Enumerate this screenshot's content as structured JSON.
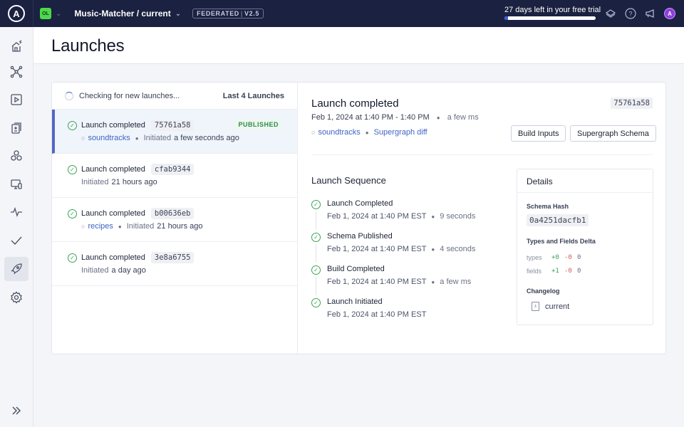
{
  "topbar": {
    "logo_letter": "A",
    "org_initials": "OL",
    "graph_name": "Music-Matcher / current",
    "badge_type": "FEDERATED",
    "badge_version": "V2.5",
    "trial_text": "27 days left in your free trial",
    "trial_progress_percent": 4,
    "avatar_initial": "A",
    "icons": [
      "graph-layers-icon",
      "help-icon",
      "announcements-icon",
      "avatar"
    ]
  },
  "sidebar": {
    "items": [
      {
        "name": "home",
        "icon": "house-icon",
        "active": false
      },
      {
        "name": "schema",
        "icon": "graph-nodes-icon",
        "active": false
      },
      {
        "name": "explorer",
        "icon": "play-icon",
        "active": false
      },
      {
        "name": "changelog",
        "icon": "diff-icon",
        "active": false
      },
      {
        "name": "subgraphs",
        "icon": "cubes-icon",
        "active": false
      },
      {
        "name": "clients",
        "icon": "devices-icon",
        "active": false
      },
      {
        "name": "insights",
        "icon": "pulse-icon",
        "active": false
      },
      {
        "name": "checks",
        "icon": "checkmark-icon",
        "active": false
      },
      {
        "name": "launches",
        "icon": "rocket-icon",
        "active": true
      },
      {
        "name": "settings",
        "icon": "gear-icon",
        "active": false
      }
    ],
    "expand_icon": "double-chevron-right-icon"
  },
  "page": {
    "title": "Launches"
  },
  "launch_list": {
    "status_text": "Checking for new launches...",
    "count_label": "Last 4 Launches",
    "items": [
      {
        "title": "Launch completed",
        "hash": "75761a58",
        "badge": "PUBLISHED",
        "subgraph": "soundtracks",
        "initiated_label": "Initiated",
        "initiated_time": "a few seconds ago",
        "selected": true
      },
      {
        "title": "Launch completed",
        "hash": "cfab9344",
        "badge": "",
        "subgraph": "",
        "initiated_label": "Initiated",
        "initiated_time": "21 hours ago",
        "selected": false
      },
      {
        "title": "Launch completed",
        "hash": "b00636eb",
        "badge": "",
        "subgraph": "recipes",
        "initiated_label": "Initiated",
        "initiated_time": "21 hours ago",
        "selected": false
      },
      {
        "title": "Launch completed",
        "hash": "3e8a6755",
        "badge": "",
        "subgraph": "",
        "initiated_label": "Initiated",
        "initiated_time": "a day ago",
        "selected": false
      }
    ]
  },
  "detail": {
    "title": "Launch completed",
    "hash": "75761a58",
    "time_range": "Feb 1, 2024 at 1:40 PM - 1:40 PM",
    "duration": "a few ms",
    "subgraph_link": "soundtracks",
    "diff_link": "Supergraph diff",
    "build_inputs_label": "Build Inputs",
    "supergraph_schema_label": "Supergraph Schema",
    "sequence_title": "Launch Sequence",
    "sequence": [
      {
        "name": "Launch Completed",
        "time": "Feb 1, 2024 at 1:40 PM EST",
        "duration": "9 seconds"
      },
      {
        "name": "Schema Published",
        "time": "Feb 1, 2024 at 1:40 PM EST",
        "duration": "4 seconds"
      },
      {
        "name": "Build Completed",
        "time": "Feb 1, 2024 at 1:40 PM EST",
        "duration": "a few ms"
      },
      {
        "name": "Launch Initiated",
        "time": "Feb 1, 2024 at 1:40 PM EST",
        "duration": ""
      }
    ],
    "details_box": {
      "title": "Details",
      "schema_hash_label": "Schema Hash",
      "schema_hash": "0a4251dacfb1",
      "delta_label": "Types and Fields Delta",
      "types": {
        "label": "types",
        "added": "+0",
        "removed": "-0",
        "total": "0"
      },
      "fields": {
        "label": "fields",
        "added": "+1",
        "removed": "-0",
        "total": "0"
      },
      "changelog_label": "Changelog",
      "changelog_item": "current"
    }
  },
  "colors": {
    "topbar_bg": "#1b2140",
    "accent": "#5467c4",
    "link": "#3f64c4",
    "success": "#3aa356",
    "danger": "#d45a5a",
    "org_badge": "#4cd94c"
  }
}
